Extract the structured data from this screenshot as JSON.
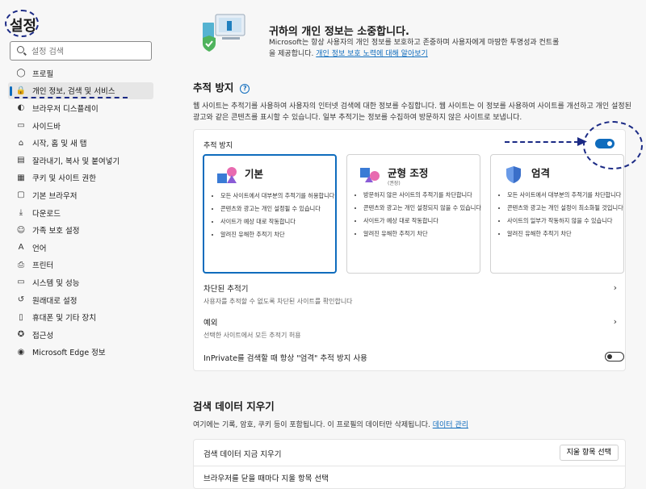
{
  "sidebar": {
    "title": "설정",
    "search_placeholder": "설정 검색",
    "items": [
      {
        "label": "프로필",
        "icon": "profile-icon",
        "glyph": "◯"
      },
      {
        "label": "개인 정보, 검색 및 서비스",
        "icon": "lock-icon",
        "glyph": "🔒"
      },
      {
        "label": "브라우저 디스플레이",
        "icon": "appearance-icon",
        "glyph": "◐"
      },
      {
        "label": "사이드바",
        "icon": "sidebar-icon",
        "glyph": "▭"
      },
      {
        "label": "시작, 홈 및 새 탭",
        "icon": "home-icon",
        "glyph": "⌂"
      },
      {
        "label": "잘라내기, 복사 및 붙여넣기",
        "icon": "clipboard-icon",
        "glyph": "▤"
      },
      {
        "label": "쿠키 및 사이트 권한",
        "icon": "cookie-icon",
        "glyph": "▦"
      },
      {
        "label": "기본 브라우저",
        "icon": "browser-icon",
        "glyph": "▢"
      },
      {
        "label": "다운로드",
        "icon": "download-icon",
        "glyph": "⤓"
      },
      {
        "label": "가족 보호 설정",
        "icon": "family-icon",
        "glyph": "☺"
      },
      {
        "label": "언어",
        "icon": "language-icon",
        "glyph": "A"
      },
      {
        "label": "프린터",
        "icon": "printer-icon",
        "glyph": "⎙"
      },
      {
        "label": "시스템 및 성능",
        "icon": "system-icon",
        "glyph": "▭"
      },
      {
        "label": "원래대로 설정",
        "icon": "reset-icon",
        "glyph": "↺"
      },
      {
        "label": "휴대폰 및 기타 장치",
        "icon": "phone-icon",
        "glyph": "▯"
      },
      {
        "label": "접근성",
        "icon": "accessibility-icon",
        "glyph": "✪"
      },
      {
        "label": "Microsoft Edge 정보",
        "icon": "edge-icon",
        "glyph": "◉"
      }
    ]
  },
  "hero": {
    "title": "귀하의 개인 정보는 소중합니다.",
    "desc": "Microsoft는 항상 사용자의 개인 정보를 보호하고 존중하며 사용자에게 마땅한 투명성과 컨트롤을 제공합니다.",
    "link": "개인 정보 보호 노력에 대해 알아보기"
  },
  "tracking": {
    "title": "추적 방지",
    "desc": "웹 사이트는 추적기를 사용하여 사용자의 인터넷 검색에 대한 정보를 수집합니다. 웹 사이트는 이 정보를 사용하여 사이트를 개선하고 개인 설정된 광고와 같은 콘텐츠를 표시할 수 있습니다. 일부 추적기는 정보를 수집하여 방문하지 않은 사이트로 보냅니다.",
    "toggle_label": "추적 방지",
    "toggle_on": true,
    "options": [
      {
        "title": "기본",
        "sub": "",
        "bullets": [
          "모든 사이트에서 대부분의 추적기를 허용합니다",
          "콘텐츠와 광고는 개인 설정될 수 있습니다",
          "사이트가 예상 대로 작동합니다",
          "알려진 유해한 추적기 차단"
        ]
      },
      {
        "title": "균형 조정",
        "sub": "(권장)",
        "bullets": [
          "방문하지 않은 사이트의 추적기를 차단합니다",
          "콘텐츠와 광고는 개인 설정되지 않을 수 있습니다",
          "사이트가 예상 대로 작동합니다",
          "알려진 유해한 추적기 차단"
        ]
      },
      {
        "title": "엄격",
        "sub": "",
        "bullets": [
          "모든 사이트에서 대부분의 추적기를 차단합니다",
          "콘텐츠와 광고는 개인 설정이 최소화될 것입니다",
          "사이트의 일부가 작동하지 않을 수 있습니다",
          "알려진 유해한 추적기 차단"
        ]
      }
    ],
    "blocked_title": "차단된 추적기",
    "blocked_desc": "사용자를 추적할 수 없도록 차단된 사이트를 확인합니다",
    "exceptions_title": "예외",
    "exceptions_desc": "선택한 사이트에서 모든 추적기 허용",
    "inprivate_label": "InPrivate를 검색할 때 항상 \"엄격\" 추적 방지 사용",
    "inprivate_on": false
  },
  "clear": {
    "title": "검색 데이터 지우기",
    "desc": "여기에는 기록, 암호, 쿠키 등이 포함됩니다. 이 프로필의 데이터만 삭제됩니다.",
    "link": "데이터 관리",
    "now_label": "검색 데이터 지금 지우기",
    "button": "지울 항목 선택",
    "next_row": "브라우저를 닫을 때마다 지울 항목 선택"
  },
  "colors": {
    "accent": "#0f6cbd",
    "annotation": "#1b2a85"
  }
}
